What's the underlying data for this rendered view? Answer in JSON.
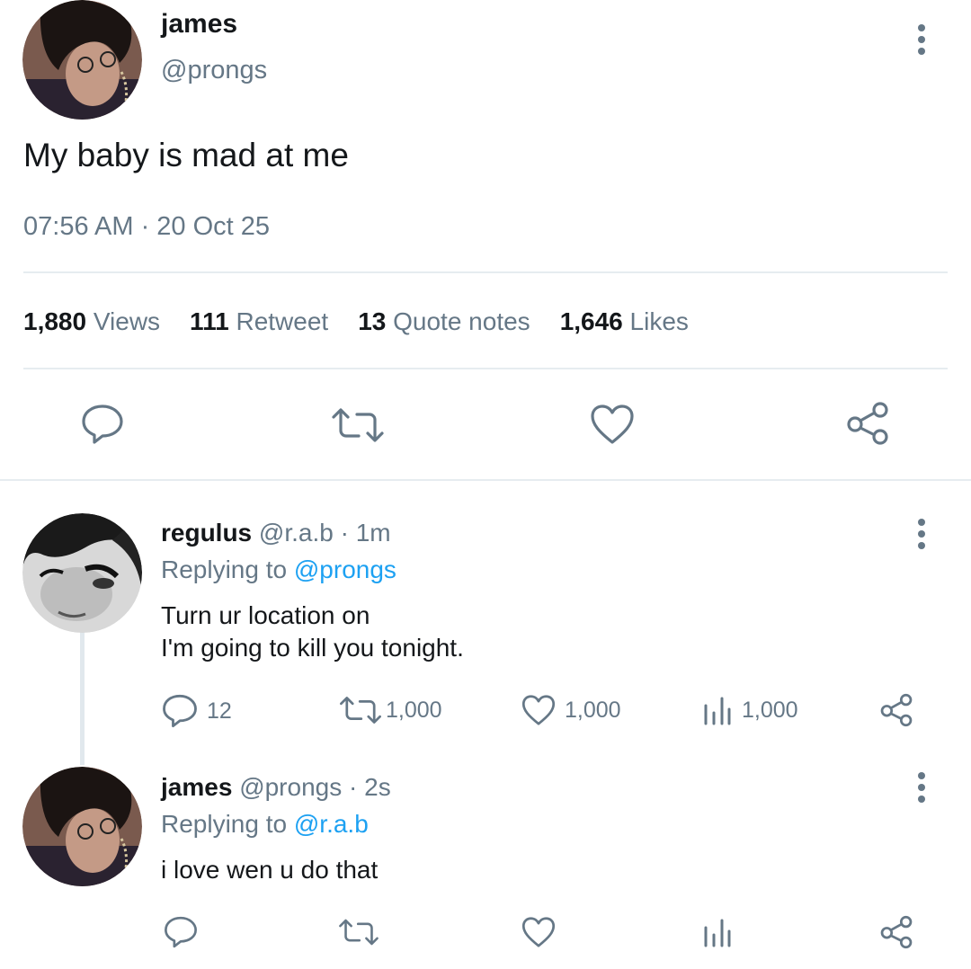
{
  "main_tweet": {
    "author_name": "james",
    "handle": "@prongs",
    "text": "My baby is mad at me",
    "timestamp": "07:56 AM · 20 Oct 25",
    "stats": [
      {
        "count": "1,880",
        "label": "Views"
      },
      {
        "count": "111",
        "label": "Retweet"
      },
      {
        "count": "13",
        "label": "Quote notes"
      },
      {
        "count": "1,646",
        "label": "Likes"
      }
    ]
  },
  "replies": [
    {
      "author_name": "regulus",
      "handle": "@r.a.b",
      "time": "· 1m",
      "replying_prefix": "Replying to",
      "replying_to": "@prongs",
      "text_line1": "Turn ur location on",
      "text_line2": "I'm going to kill you tonight.",
      "counts": {
        "replies": "12",
        "retweets": "1,000",
        "likes": "1,000",
        "views": "1,000"
      }
    },
    {
      "author_name": "james",
      "handle": "@prongs",
      "time": "· 2s",
      "replying_prefix": "Replying to",
      "replying_to": "@r.a.b",
      "text_line1": "i love wen u do that"
    }
  ],
  "colors": {
    "muted": "#657786",
    "link": "#1da1f2",
    "divider": "#e6ecf0"
  },
  "icons": [
    "more-vertical-icon",
    "reply-icon",
    "retweet-icon",
    "like-icon",
    "share-icon",
    "views-icon"
  ]
}
